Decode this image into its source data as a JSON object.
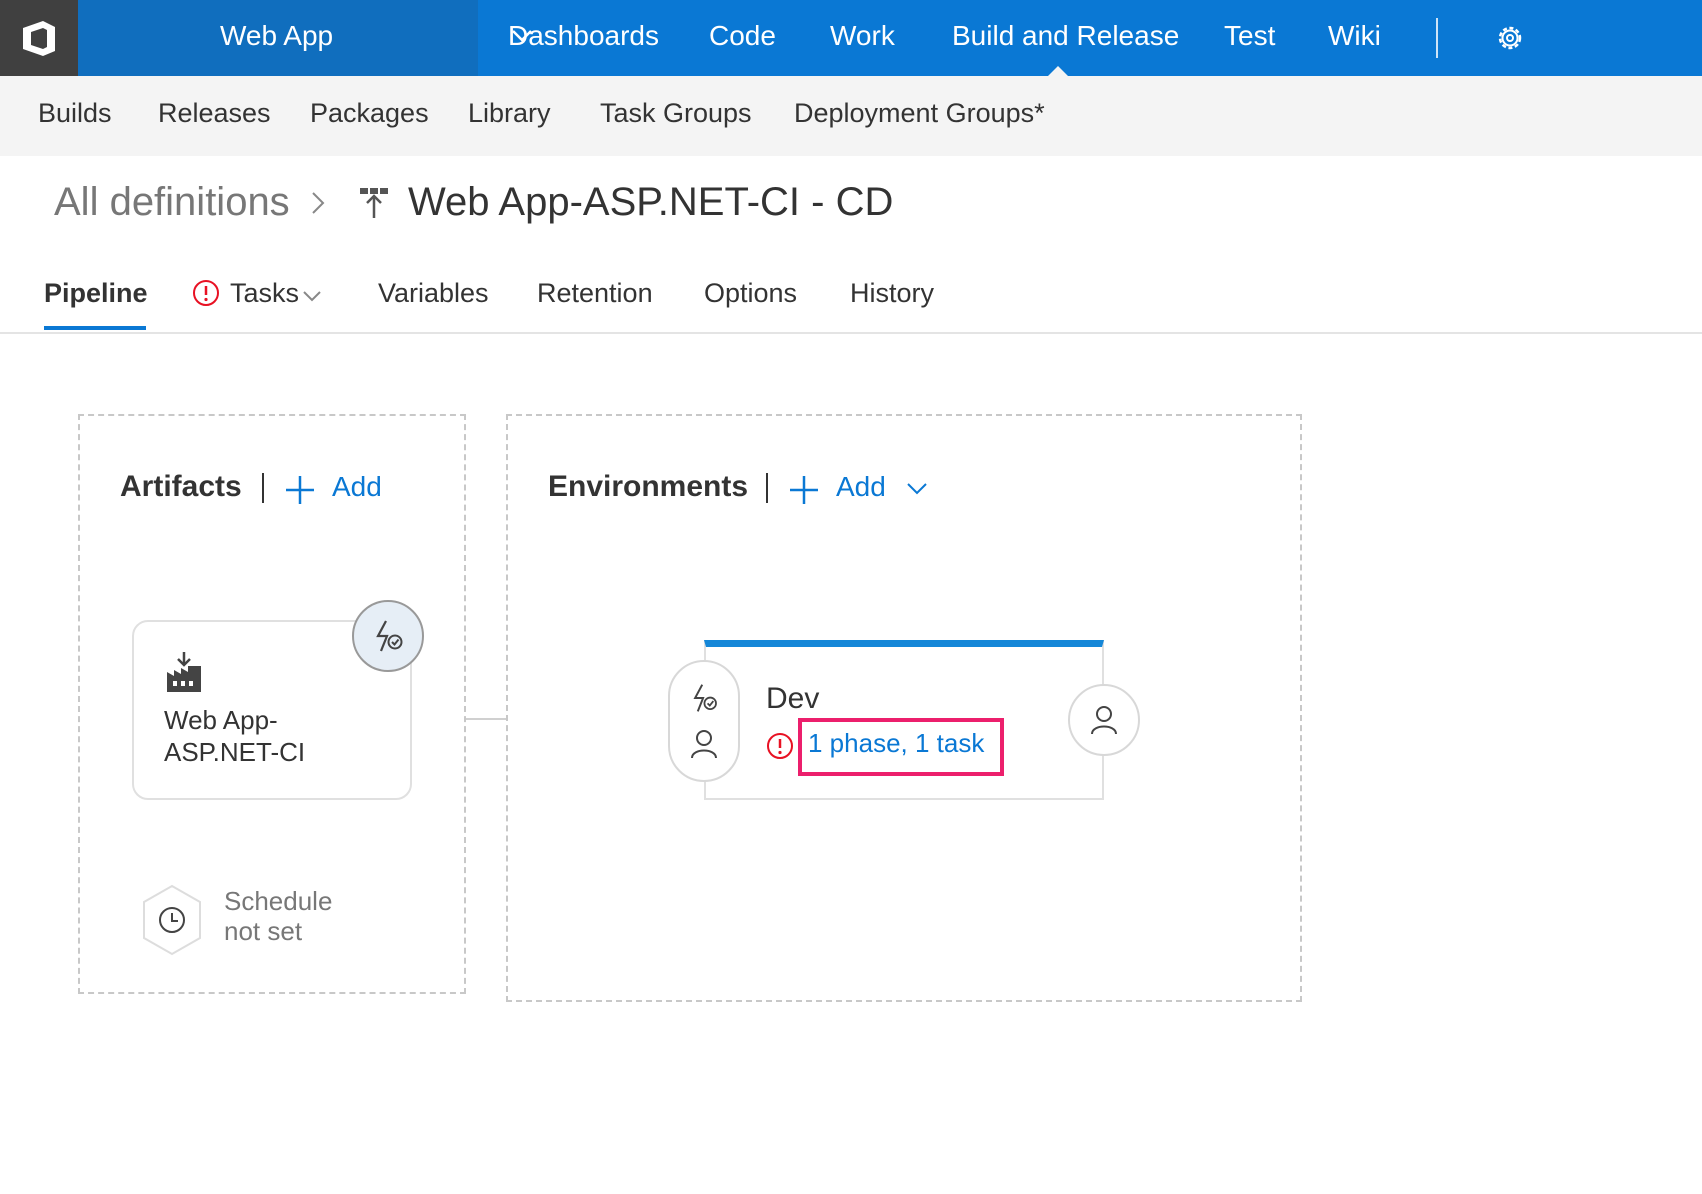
{
  "topnav": {
    "project": "Web App",
    "items": [
      "Dashboards",
      "Code",
      "Work",
      "Build and Release",
      "Test",
      "Wiki"
    ],
    "active_item": "Build and Release"
  },
  "subnav": {
    "items": [
      "Builds",
      "Releases",
      "Packages",
      "Library",
      "Task Groups",
      "Deployment Groups*"
    ]
  },
  "breadcrumb": {
    "root": "All definitions",
    "title": "Web App-ASP.NET-CI - CD"
  },
  "tabs": {
    "items": [
      "Pipeline",
      "Tasks",
      "Variables",
      "Retention",
      "Options",
      "History"
    ],
    "active": "Pipeline"
  },
  "artifacts": {
    "title": "Artifacts",
    "add_label": "Add",
    "card_name": "Web App-ASP.NET-CI",
    "schedule_line1": "Schedule",
    "schedule_line2": "not set"
  },
  "environments": {
    "title": "Environments",
    "add_label": "Add",
    "env_name": "Dev",
    "env_summary": "1 phase, 1 task"
  },
  "colors": {
    "nav_blue": "#0a78d4",
    "project_blue": "#106ebe",
    "logo_gray": "#404040",
    "warning_red": "#e81123",
    "highlight_pink": "#ec1f6c",
    "env_accent": "#1587d8"
  },
  "icons": {
    "logo": "vsts-logo-icon",
    "project_dropdown": "chevron-down-icon",
    "settings": "gear-icon",
    "breadcrumb_sep": "chevron-right-icon",
    "definition": "release-definition-icon",
    "tasks_warning": "warning-circle-icon",
    "artifact": "build-artifact-icon",
    "trigger": "lightning-trigger-icon",
    "approver": "person-icon",
    "schedule": "clock-icon"
  }
}
